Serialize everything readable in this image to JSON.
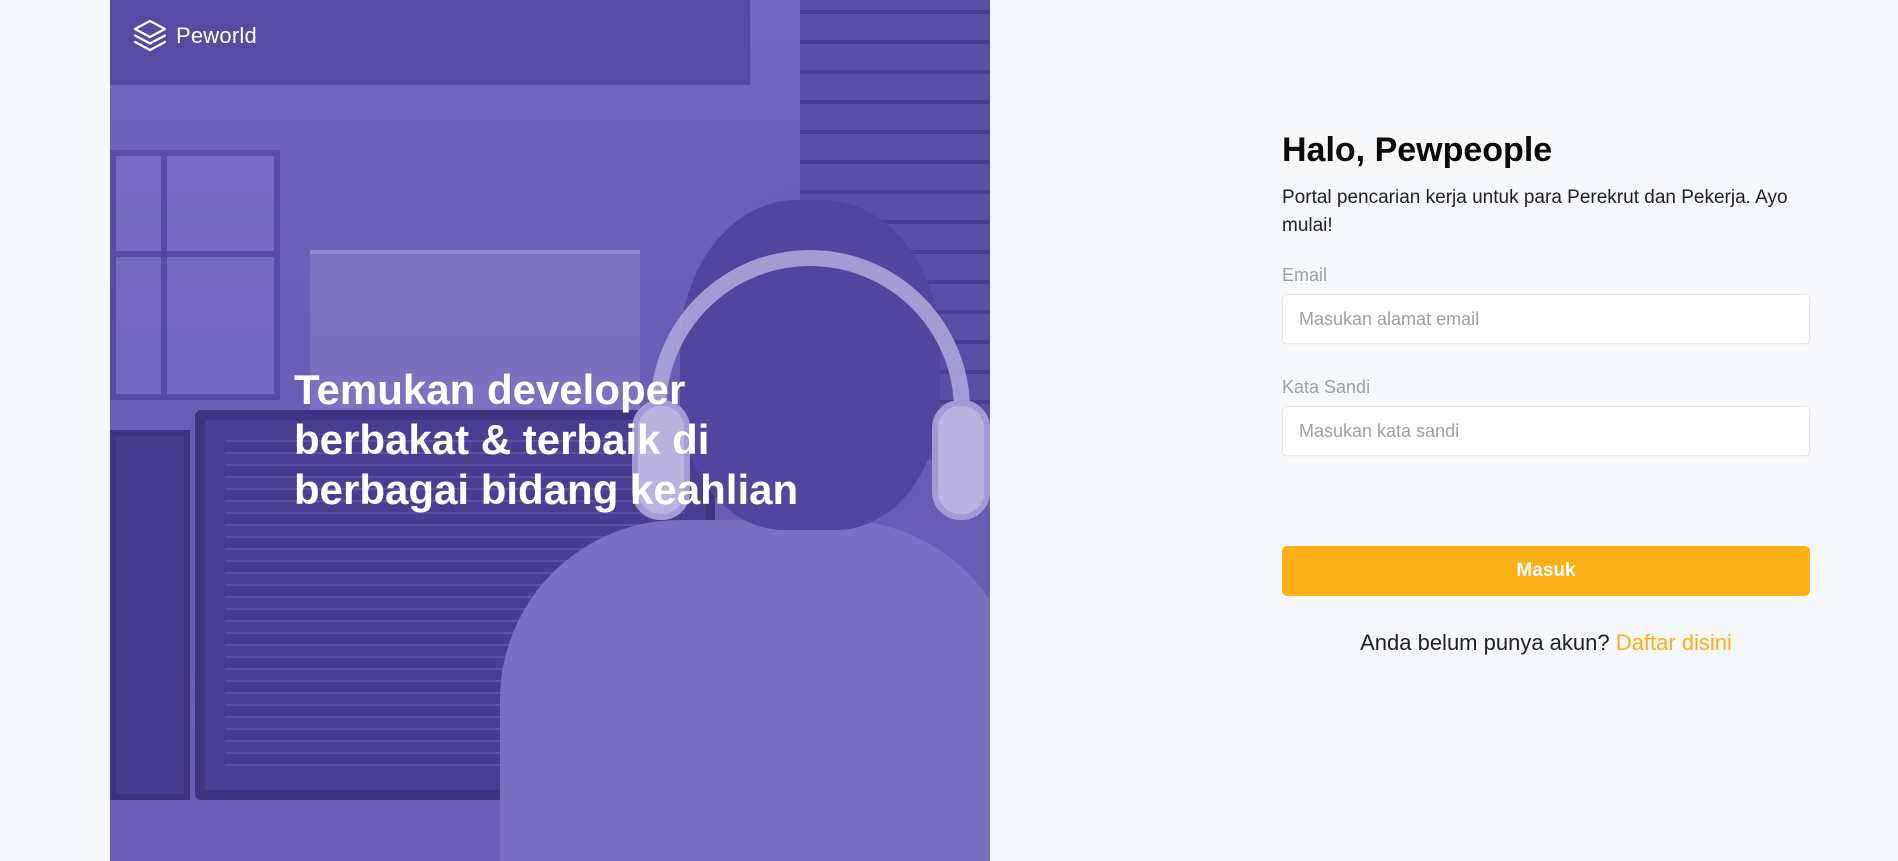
{
  "brand": {
    "name": "Peworld",
    "logo_icon": "layers-icon"
  },
  "hero": {
    "headline": "Temukan developer berbakat & terbaik di berbagai bidang keahlian"
  },
  "login": {
    "greeting": "Halo, Pewpeople",
    "subtitle": "Portal pencarian kerja untuk para Perekrut dan Pekerja. Ayo mulai!",
    "email_label": "Email",
    "email_placeholder": "Masukan alamat email",
    "email_value": "",
    "password_label": "Kata Sandi",
    "password_placeholder": "Masukan kata sandi",
    "password_value": "",
    "submit_label": "Masuk",
    "register_prompt": "Anda belum punya akun?",
    "register_link": "Daftar disini"
  },
  "colors": {
    "accent": "#fbb017",
    "hero_overlay": "#5e50b4",
    "background": "#f6f7f8"
  }
}
